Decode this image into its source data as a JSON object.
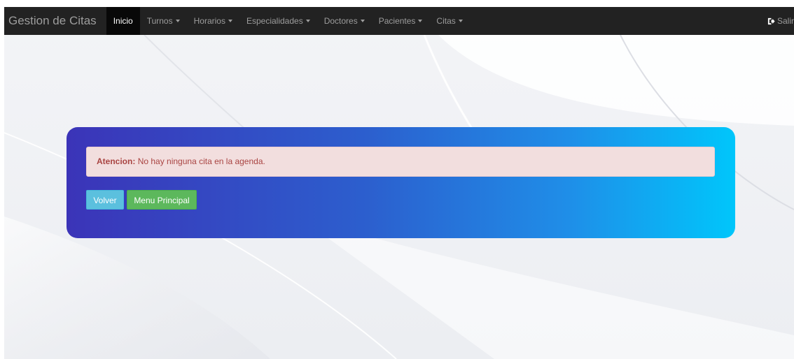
{
  "navbar": {
    "brand": "Gestion de Citas",
    "items": [
      {
        "label": "Inicio",
        "active": true,
        "dropdown": false
      },
      {
        "label": "Turnos",
        "active": false,
        "dropdown": true
      },
      {
        "label": "Horarios",
        "active": false,
        "dropdown": true
      },
      {
        "label": "Especialidades",
        "active": false,
        "dropdown": true
      },
      {
        "label": "Doctores",
        "active": false,
        "dropdown": true
      },
      {
        "label": "Pacientes",
        "active": false,
        "dropdown": true
      },
      {
        "label": "Citas",
        "active": false,
        "dropdown": true
      }
    ],
    "logout": {
      "label": "Salir",
      "icon": "logout-icon"
    }
  },
  "alert": {
    "title": "Atencion:",
    "message": "No hay ninguna cita en la agenda."
  },
  "buttons": {
    "back_label": "Volver",
    "menu_label": "Menu Principal"
  },
  "colors": {
    "navbar_bg": "#222222",
    "panel_gradient_start": "#3b34b8",
    "panel_gradient_end": "#00c6fb",
    "alert_bg": "#f2dede",
    "alert_text": "#a94442",
    "btn_info": "#5bc0de",
    "btn_success": "#5cb85c"
  }
}
